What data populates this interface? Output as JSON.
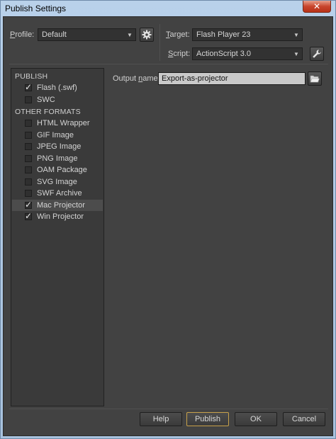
{
  "window": {
    "title": "Publish Settings",
    "close_glyph": "✕"
  },
  "profile": {
    "label_accel": "P",
    "label_rest": "rofile:",
    "value": "Default"
  },
  "target": {
    "label_accel": "T",
    "label_rest": "arget:",
    "value": "Flash Player 23"
  },
  "script": {
    "label_accel": "S",
    "label_rest": "cript:",
    "value": "ActionScript 3.0"
  },
  "left_panel": {
    "publish_header": "PUBLISH",
    "publish_items": [
      {
        "label": "Flash (.swf)",
        "checked": true
      },
      {
        "label": "SWC",
        "checked": false
      }
    ],
    "other_header": "OTHER FORMATS",
    "other_items": [
      {
        "label": "HTML Wrapper",
        "checked": false
      },
      {
        "label": "GIF Image",
        "checked": false
      },
      {
        "label": "JPEG Image",
        "checked": false
      },
      {
        "label": "PNG Image",
        "checked": false
      },
      {
        "label": "OAM Package",
        "checked": false
      },
      {
        "label": "SVG Image",
        "checked": false
      },
      {
        "label": "SWF Archive",
        "checked": false
      },
      {
        "label": "Mac Projector",
        "checked": true,
        "selected": true
      },
      {
        "label": "Win Projector",
        "checked": true
      }
    ]
  },
  "output": {
    "label_pre": "Output ",
    "label_accel": "n",
    "label_rest": "ame:",
    "value": "Export-as-projector"
  },
  "buttons": {
    "help": "Help",
    "publish": "Publish",
    "ok": "OK",
    "cancel": "Cancel"
  },
  "icons": {
    "gear": "gear-icon",
    "wrench": "wrench-icon",
    "folder": "folder-icon",
    "dropdown": "chevron-down-icon"
  }
}
